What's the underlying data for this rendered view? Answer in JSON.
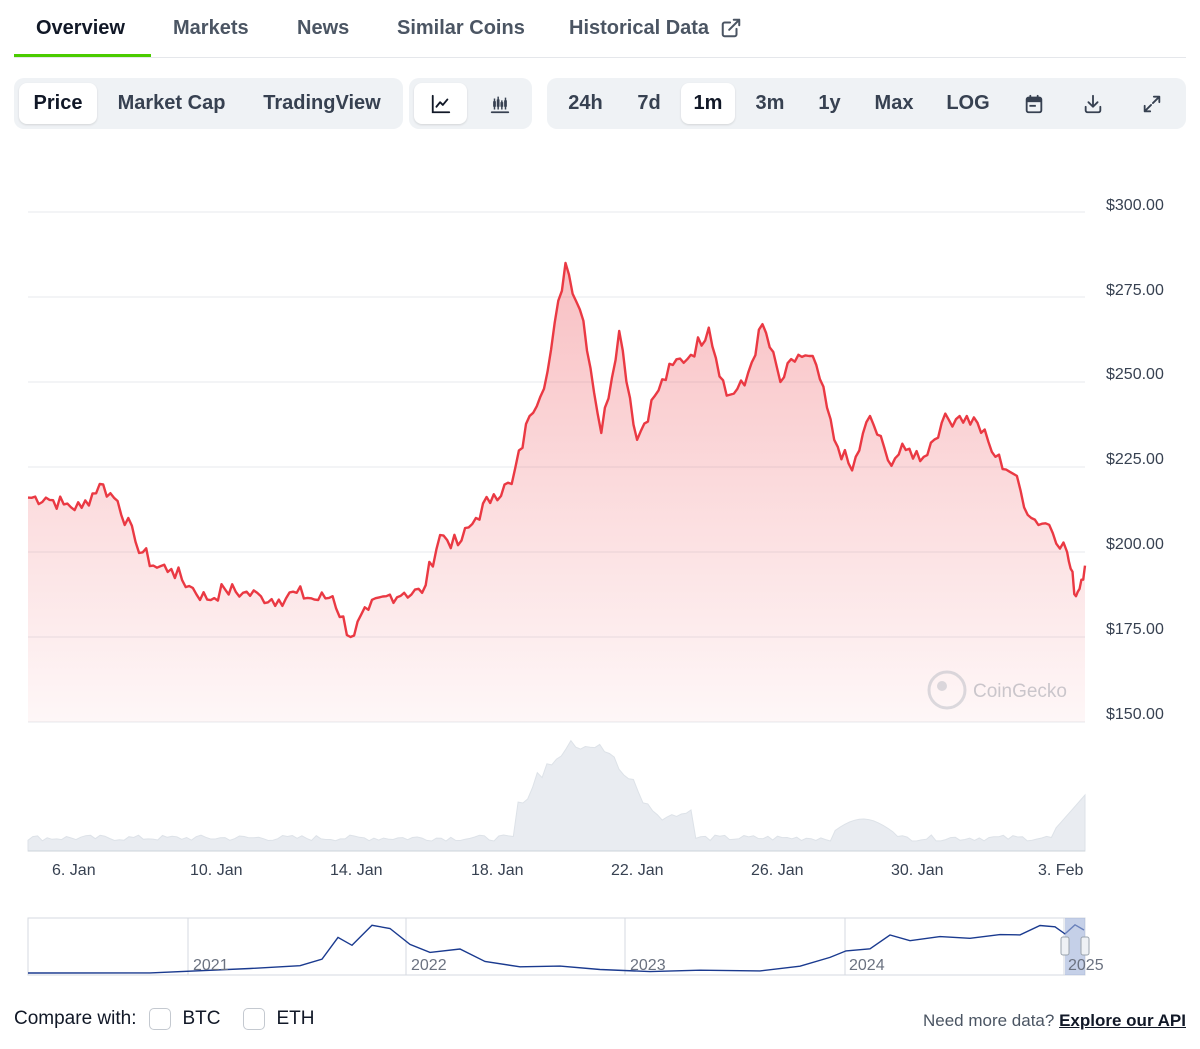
{
  "tabs": [
    {
      "label": "Overview",
      "active": true
    },
    {
      "label": "Markets"
    },
    {
      "label": "News"
    },
    {
      "label": "Similar Coins"
    },
    {
      "label": "Historical Data",
      "external": true
    }
  ],
  "view_toggle": {
    "items": [
      "Price",
      "Market Cap",
      "TradingView"
    ],
    "selected": "Price"
  },
  "chart_type_toggle": {
    "items": [
      "line-chart-icon",
      "candlestick-icon"
    ],
    "selected": "line-chart-icon"
  },
  "range_toggle": {
    "items": [
      "24h",
      "7d",
      "1m",
      "3m",
      "1y",
      "Max",
      "LOG"
    ],
    "selected": "1m"
  },
  "tool_icons": [
    "calendar-icon",
    "download-icon",
    "expand-icon"
  ],
  "watermark": "CoinGecko",
  "colors": {
    "line": "#ea3943",
    "accent": "#4bcc00",
    "navigator": "#1a3a8f"
  },
  "chart_data": {
    "type": "line",
    "title": "",
    "xlabel": "",
    "ylabel": "",
    "ylim": [
      150,
      300
    ],
    "yticks": [
      "$300.00",
      "$275.00",
      "$250.00",
      "$225.00",
      "$200.00",
      "$175.00",
      "$150.00"
    ],
    "xticks": [
      "6. Jan",
      "10. Jan",
      "14. Jan",
      "18. Jan",
      "22. Jan",
      "26. Jan",
      "30. Jan",
      "3. Feb"
    ],
    "series": [
      {
        "values": [
          {
            "x": "2025-01-05 00:00",
            "y": 216
          },
          {
            "x": "2025-01-05 12:00",
            "y": 216
          },
          {
            "x": "2025-01-06 00:00",
            "y": 214
          },
          {
            "x": "2025-01-06 12:00",
            "y": 213
          },
          {
            "x": "2025-01-07 00:00",
            "y": 220
          },
          {
            "x": "2025-01-07 12:00",
            "y": 215
          },
          {
            "x": "2025-01-08 00:00",
            "y": 203
          },
          {
            "x": "2025-01-08 12:00",
            "y": 196
          },
          {
            "x": "2025-01-09 00:00",
            "y": 195
          },
          {
            "x": "2025-01-09 12:00",
            "y": 190
          },
          {
            "x": "2025-01-10 00:00",
            "y": 186
          },
          {
            "x": "2025-01-10 12:00",
            "y": 189
          },
          {
            "x": "2025-01-11 00:00",
            "y": 188
          },
          {
            "x": "2025-01-11 12:00",
            "y": 187
          },
          {
            "x": "2025-01-12 00:00",
            "y": 186
          },
          {
            "x": "2025-01-12 12:00",
            "y": 188
          },
          {
            "x": "2025-01-13 00:00",
            "y": 186
          },
          {
            "x": "2025-01-13 12:00",
            "y": 187
          },
          {
            "x": "2025-01-14 00:00",
            "y": 175
          },
          {
            "x": "2025-01-14 12:00",
            "y": 183
          },
          {
            "x": "2025-01-15 00:00",
            "y": 187
          },
          {
            "x": "2025-01-15 12:00",
            "y": 188
          },
          {
            "x": "2025-01-16 00:00",
            "y": 188
          },
          {
            "x": "2025-01-16 12:00",
            "y": 205
          },
          {
            "x": "2025-01-17 00:00",
            "y": 202
          },
          {
            "x": "2025-01-17 12:00",
            "y": 210
          },
          {
            "x": "2025-01-18 00:00",
            "y": 217
          },
          {
            "x": "2025-01-18 12:00",
            "y": 220
          },
          {
            "x": "2025-01-19 00:00",
            "y": 240
          },
          {
            "x": "2025-01-19 12:00",
            "y": 253
          },
          {
            "x": "2025-01-20 00:00",
            "y": 285
          },
          {
            "x": "2025-01-20 12:00",
            "y": 268
          },
          {
            "x": "2025-01-21 00:00",
            "y": 235
          },
          {
            "x": "2025-01-21 12:00",
            "y": 265
          },
          {
            "x": "2025-01-22 00:00",
            "y": 233
          },
          {
            "x": "2025-01-22 12:00",
            "y": 246
          },
          {
            "x": "2025-01-23 00:00",
            "y": 255
          },
          {
            "x": "2025-01-23 12:00",
            "y": 258
          },
          {
            "x": "2025-01-24 00:00",
            "y": 266
          },
          {
            "x": "2025-01-24 12:00",
            "y": 246
          },
          {
            "x": "2025-01-25 00:00",
            "y": 249
          },
          {
            "x": "2025-01-25 12:00",
            "y": 267
          },
          {
            "x": "2025-01-26 00:00",
            "y": 250
          },
          {
            "x": "2025-01-26 12:00",
            "y": 258
          },
          {
            "x": "2025-01-27 00:00",
            "y": 255
          },
          {
            "x": "2025-01-27 12:00",
            "y": 233
          },
          {
            "x": "2025-01-28 00:00",
            "y": 224
          },
          {
            "x": "2025-01-28 12:00",
            "y": 240
          },
          {
            "x": "2025-01-29 00:00",
            "y": 227
          },
          {
            "x": "2025-01-29 12:00",
            "y": 230
          },
          {
            "x": "2025-01-30 00:00",
            "y": 228
          },
          {
            "x": "2025-01-30 12:00",
            "y": 238
          },
          {
            "x": "2025-01-31 00:00",
            "y": 240
          },
          {
            "x": "2025-01-31 12:00",
            "y": 238
          },
          {
            "x": "2025-02-01 00:00",
            "y": 228
          },
          {
            "x": "2025-02-01 12:00",
            "y": 223
          },
          {
            "x": "2025-02-02 00:00",
            "y": 210
          },
          {
            "x": "2025-02-02 12:00",
            "y": 208
          },
          {
            "x": "2025-02-03 00:00",
            "y": 200
          },
          {
            "x": "2025-02-03 06:00",
            "y": 187
          },
          {
            "x": "2025-02-03 12:00",
            "y": 196
          }
        ]
      }
    ],
    "navigator_years": [
      "2021",
      "2022",
      "2023",
      "2024",
      "2025"
    ],
    "grid": true
  },
  "compare": {
    "label": "Compare with:",
    "options": [
      "BTC",
      "ETH"
    ]
  },
  "api": {
    "prefix": "Need more data?",
    "link": "Explore our API"
  }
}
